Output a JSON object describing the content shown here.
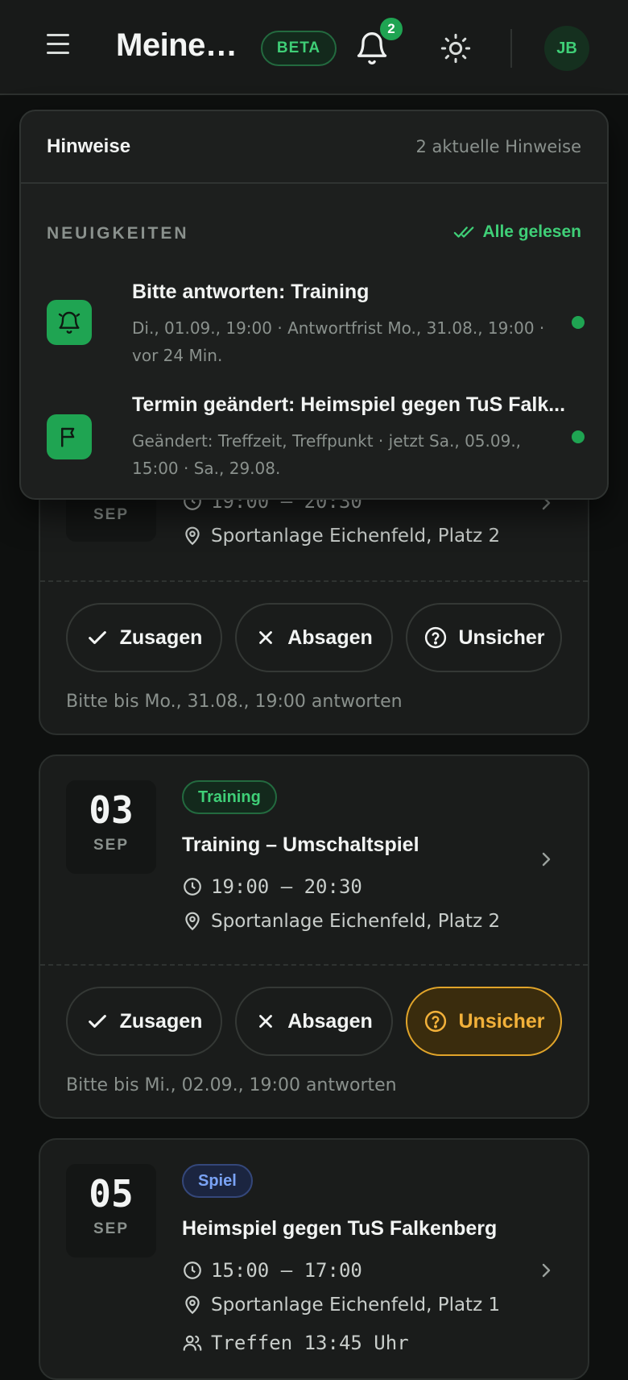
{
  "header": {
    "title": "Meine…",
    "beta_label": "BETA",
    "notification_count": "2",
    "avatar_initials": "JB"
  },
  "notifications": {
    "title": "Hinweise",
    "count_label": "2 aktuelle Hinweise",
    "section_label": "NEUIGKEITEN",
    "mark_all_read": "Alle gelesen",
    "items": [
      {
        "title": "Bitte antworten: Training",
        "meta": "Di., 01.09., 19:00 · Antwortfrist Mo., 31.08., 19:00 · vor 24 Min.",
        "icon": "bell-ring-icon",
        "unread": true
      },
      {
        "title": "Termin geändert: Heimspiel gegen TuS Falk...",
        "meta": "Geändert: Treffzeit, Treffpunkt · jetzt Sa., 05.09., 15:00 · Sa., 29.08.",
        "icon": "flag-icon",
        "unread": true
      }
    ]
  },
  "events": [
    {
      "month": "SEP",
      "time": "19:00 – 20:30",
      "location": "Sportanlage Eichenfeld, Platz 2",
      "rsvp": {
        "accept": "Zusagen",
        "decline": "Absagen",
        "unsure": "Unsicher",
        "selected": "none"
      },
      "deadline": "Bitte bis Mo., 31.08., 19:00 antworten"
    },
    {
      "day": "03",
      "month": "SEP",
      "tag": "Training",
      "title": "Training – Umschaltspiel",
      "time": "19:00 – 20:30",
      "location": "Sportanlage Eichenfeld, Platz 2",
      "rsvp": {
        "accept": "Zusagen",
        "decline": "Absagen",
        "unsure": "Unsicher",
        "selected": "unsure"
      },
      "deadline": "Bitte bis Mi., 02.09., 19:00 antworten"
    },
    {
      "day": "05",
      "month": "SEP",
      "tag": "Spiel",
      "title": "Heimspiel gegen TuS Falkenberg",
      "time": "15:00 – 17:00",
      "location": "Sportanlage Eichenfeld, Platz 1",
      "meet": "Treffen 13:45 Uhr"
    }
  ],
  "colors": {
    "accent_green": "#1fa452",
    "unsure_amber": "#f2b13a",
    "spiel_blue": "#7aa3f5"
  }
}
